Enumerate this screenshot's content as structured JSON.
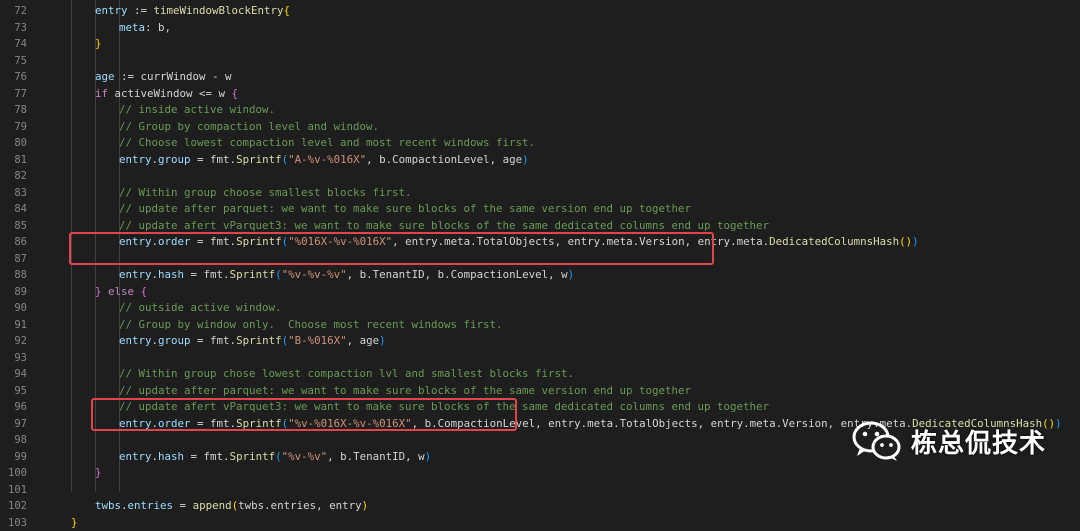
{
  "editor": {
    "colors": {
      "background": "#1e1e1e",
      "keyword": "#c586c0",
      "variable": "#9cdcfe",
      "function": "#dcdcaa",
      "string": "#ce9178",
      "comment": "#6a9955",
      "operator": "#d4d4d4",
      "bracket_gold": "#ffd700",
      "bracket_pink": "#da70d6",
      "bracket_blue": "#179fff",
      "highlight_box": "#e0454b"
    },
    "lines": [
      {
        "n": "72",
        "indent": 2,
        "tokens": [
          [
            "v",
            "entry"
          ],
          [
            "o",
            " := "
          ],
          [
            "f",
            "timeWindowBlockEntry"
          ],
          [
            "b1",
            "{"
          ]
        ]
      },
      {
        "n": "73",
        "indent": 3,
        "tokens": [
          [
            "v",
            "meta"
          ],
          [
            "o",
            ": b,"
          ]
        ]
      },
      {
        "n": "74",
        "indent": 2,
        "tokens": [
          [
            "b1",
            "}"
          ]
        ]
      },
      {
        "n": "75",
        "indent": 0,
        "tokens": []
      },
      {
        "n": "76",
        "indent": 2,
        "tokens": [
          [
            "v",
            "age"
          ],
          [
            "o",
            " := currWindow - w"
          ]
        ]
      },
      {
        "n": "77",
        "indent": 2,
        "tokens": [
          [
            "k",
            "if"
          ],
          [
            "o",
            " activeWindow <= w "
          ],
          [
            "b2",
            "{"
          ]
        ]
      },
      {
        "n": "78",
        "indent": 3,
        "tokens": [
          [
            "c",
            "// inside active window."
          ]
        ]
      },
      {
        "n": "79",
        "indent": 3,
        "tokens": [
          [
            "c",
            "// Group by compaction level and window."
          ]
        ]
      },
      {
        "n": "80",
        "indent": 3,
        "tokens": [
          [
            "c",
            "// Choose lowest compaction level and most recent windows first."
          ]
        ]
      },
      {
        "n": "81",
        "indent": 3,
        "tokens": [
          [
            "v",
            "entry"
          ],
          [
            "o",
            "."
          ],
          [
            "v",
            "group"
          ],
          [
            "o",
            " = fmt."
          ],
          [
            "f",
            "Sprintf"
          ],
          [
            "b3",
            "("
          ],
          [
            "s",
            "\"A-%v-%016X\""
          ],
          [
            "o",
            ", b.CompactionLevel, age"
          ],
          [
            "b3",
            ")"
          ]
        ]
      },
      {
        "n": "82",
        "indent": 0,
        "tokens": []
      },
      {
        "n": "83",
        "indent": 3,
        "tokens": [
          [
            "c",
            "// Within group choose smallest blocks first."
          ]
        ]
      },
      {
        "n": "84",
        "indent": 3,
        "tokens": [
          [
            "c",
            "// update after parquet: we want to make sure blocks of the same version end up together"
          ]
        ]
      },
      {
        "n": "85",
        "indent": 3,
        "tokens": [
          [
            "c",
            "// update afert vParquet3: we want to make sure blocks of the same dedicated columns end up together"
          ]
        ]
      },
      {
        "n": "86",
        "indent": 3,
        "tokens": [
          [
            "v",
            "entry"
          ],
          [
            "o",
            "."
          ],
          [
            "v",
            "order"
          ],
          [
            "o",
            " = fmt."
          ],
          [
            "f",
            "Sprintf"
          ],
          [
            "b3",
            "("
          ],
          [
            "s",
            "\"%016X-%v-%016X\""
          ],
          [
            "o",
            ", entry.meta.TotalObjects, entry.meta.Version, entry.meta."
          ],
          [
            "f",
            "DedicatedColumnsHash"
          ],
          [
            "b1",
            "()"
          ],
          [
            "b3",
            ")"
          ]
        ]
      },
      {
        "n": "87",
        "indent": 0,
        "tokens": []
      },
      {
        "n": "88",
        "indent": 3,
        "tokens": [
          [
            "v",
            "entry"
          ],
          [
            "o",
            "."
          ],
          [
            "v",
            "hash"
          ],
          [
            "o",
            " = fmt."
          ],
          [
            "f",
            "Sprintf"
          ],
          [
            "b3",
            "("
          ],
          [
            "s",
            "\"%v-%v-%v\""
          ],
          [
            "o",
            ", b.TenantID, b.CompactionLevel, w"
          ],
          [
            "b3",
            ")"
          ]
        ]
      },
      {
        "n": "89",
        "indent": 2,
        "tokens": [
          [
            "b2",
            "}"
          ],
          [
            "o",
            " "
          ],
          [
            "k",
            "else"
          ],
          [
            "o",
            " "
          ],
          [
            "b2",
            "{"
          ]
        ]
      },
      {
        "n": "90",
        "indent": 3,
        "tokens": [
          [
            "c",
            "// outside active window."
          ]
        ]
      },
      {
        "n": "91",
        "indent": 3,
        "tokens": [
          [
            "c",
            "// Group by window only.  Choose most recent windows first."
          ]
        ]
      },
      {
        "n": "92",
        "indent": 3,
        "tokens": [
          [
            "v",
            "entry"
          ],
          [
            "o",
            "."
          ],
          [
            "v",
            "group"
          ],
          [
            "o",
            " = fmt."
          ],
          [
            "f",
            "Sprintf"
          ],
          [
            "b3",
            "("
          ],
          [
            "s",
            "\"B-%016X\""
          ],
          [
            "o",
            ", age"
          ],
          [
            "b3",
            ")"
          ]
        ]
      },
      {
        "n": "93",
        "indent": 0,
        "tokens": []
      },
      {
        "n": "94",
        "indent": 3,
        "tokens": [
          [
            "c",
            "// Within group chose lowest compaction lvl and smallest blocks first."
          ]
        ]
      },
      {
        "n": "95",
        "indent": 3,
        "tokens": [
          [
            "c",
            "// update after parquet: we want to make sure blocks of the same version end up together"
          ]
        ]
      },
      {
        "n": "96",
        "indent": 3,
        "tokens": [
          [
            "c",
            "// update afert vParquet3: we want to make sure blocks of the same dedicated columns end up together"
          ]
        ]
      },
      {
        "n": "97",
        "indent": 3,
        "tokens": [
          [
            "v",
            "entry"
          ],
          [
            "o",
            "."
          ],
          [
            "v",
            "order"
          ],
          [
            "o",
            " = fmt."
          ],
          [
            "f",
            "Sprintf"
          ],
          [
            "b3",
            "("
          ],
          [
            "s",
            "\"%v-%016X-%v-%016X\""
          ],
          [
            "o",
            ", b.CompactionLevel, entry.meta.TotalObjects, entry.meta.Version, entry.meta."
          ],
          [
            "f",
            "DedicatedColumnsHash"
          ],
          [
            "b1",
            "()"
          ],
          [
            "b3",
            ")"
          ]
        ]
      },
      {
        "n": "98",
        "indent": 0,
        "tokens": []
      },
      {
        "n": "99",
        "indent": 3,
        "tokens": [
          [
            "v",
            "entry"
          ],
          [
            "o",
            "."
          ],
          [
            "v",
            "hash"
          ],
          [
            "o",
            " = fmt."
          ],
          [
            "f",
            "Sprintf"
          ],
          [
            "b3",
            "("
          ],
          [
            "s",
            "\"%v-%v\""
          ],
          [
            "o",
            ", b.TenantID, w"
          ],
          [
            "b3",
            ")"
          ]
        ]
      },
      {
        "n": "100",
        "indent": 2,
        "tokens": [
          [
            "b2",
            "}"
          ]
        ]
      },
      {
        "n": "101",
        "indent": 0,
        "tokens": []
      },
      {
        "n": "102",
        "indent": 2,
        "tokens": [
          [
            "v",
            "twbs"
          ],
          [
            "o",
            "."
          ],
          [
            "v",
            "entries"
          ],
          [
            "o",
            " = "
          ],
          [
            "f",
            "append"
          ],
          [
            "b1",
            "("
          ],
          [
            "o",
            "twbs.entries, entry"
          ],
          [
            "b1",
            ")"
          ]
        ]
      },
      {
        "n": "103",
        "indent": 1,
        "tokens": [
          [
            "b1",
            "}"
          ]
        ]
      }
    ]
  },
  "watermark": {
    "text": "栋总侃技术",
    "icon": "wechat-icon"
  }
}
